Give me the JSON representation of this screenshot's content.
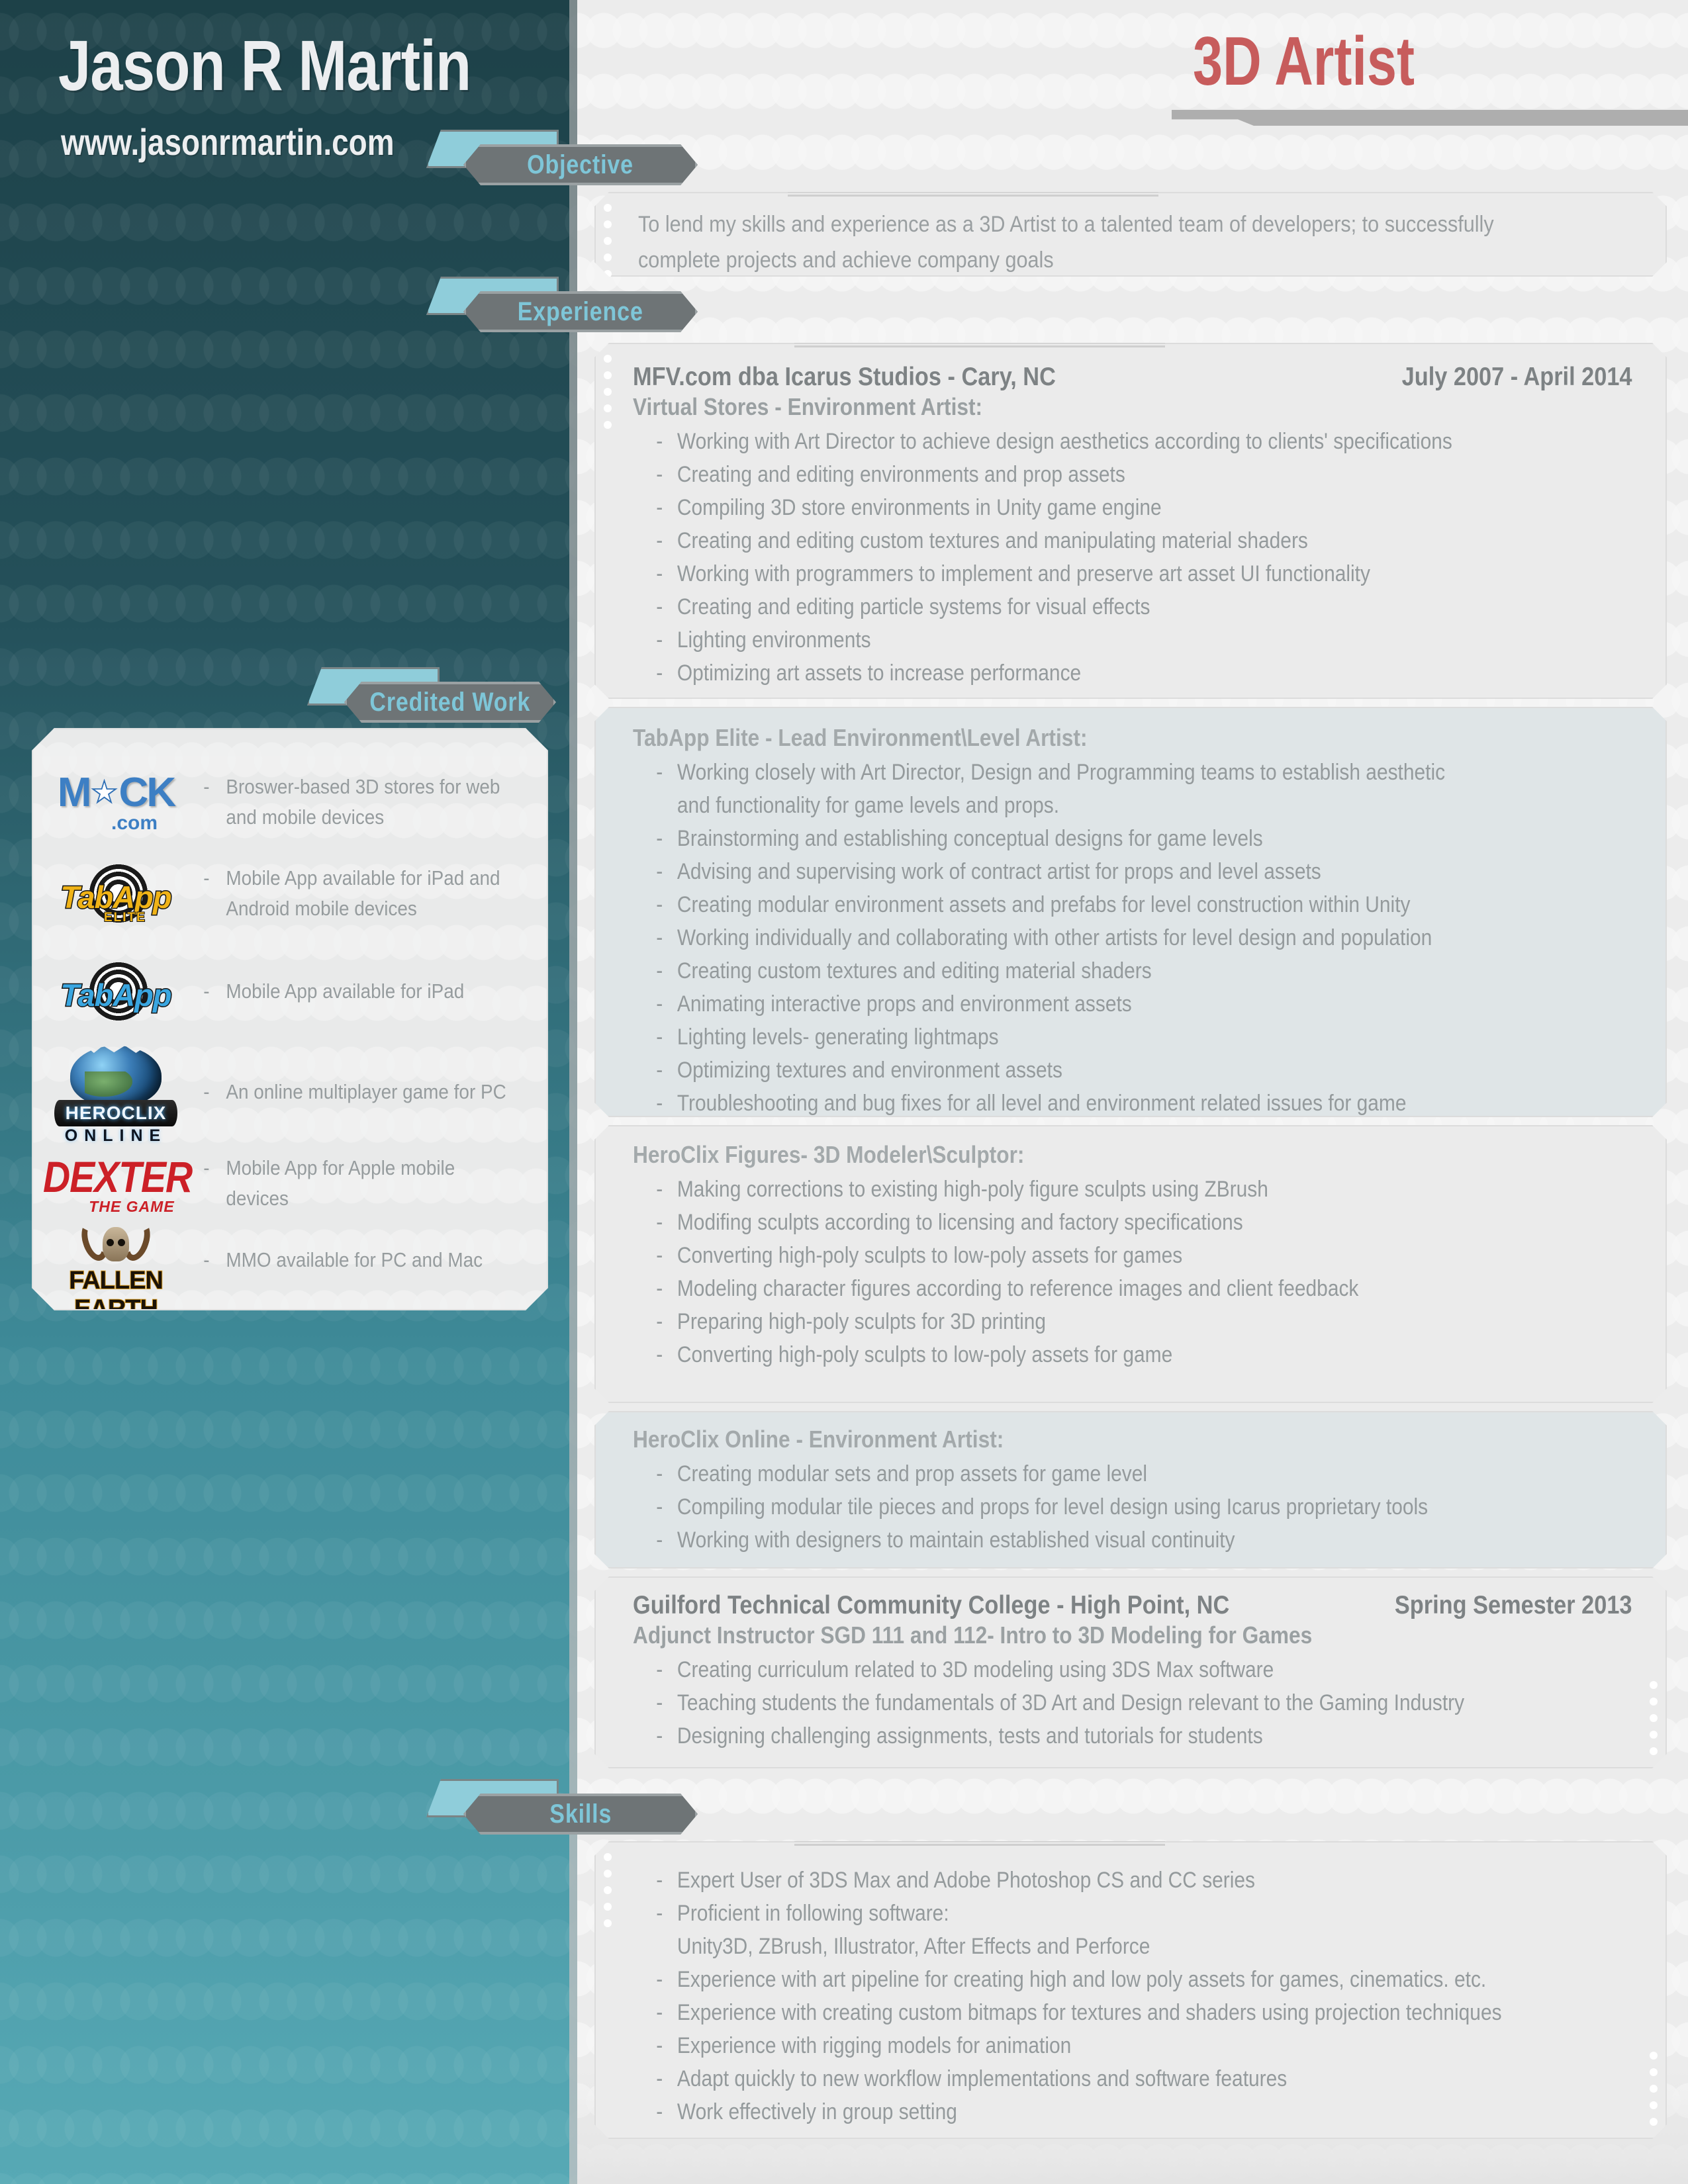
{
  "header": {
    "name": "Jason R Martin",
    "website": "www.jasonrmartin.com",
    "job_title": "3D Artist",
    "accent_red": "#c75c5c",
    "accent_blue": "#7ec6d8",
    "teal_bg": "#2b5f6b"
  },
  "sections": {
    "objective": {
      "tab_label": "Objective",
      "text": "To lend my skills and experience as a 3D Artist to a talented team of developers; to successfully complete projects and achieve company goals"
    },
    "experience": {
      "tab_label": "Experience",
      "jobs": [
        {
          "employer": "MFV.com dba Icarus Studios - Cary, NC",
          "dates": "July 2007 - April 2014",
          "roles": [
            {
              "title": "Virtual Stores - Environment Artist:",
              "shaded": false,
              "bullets": [
                "Working with Art Director to achieve design aesthetics according to clients' specifications",
                "Creating and editing environments and prop assets",
                "Compiling 3D store environments in Unity game engine",
                "Creating and editing custom textures and manipulating material shaders",
                "Working with programmers to implement and preserve art asset UI functionality",
                "Creating and editing particle systems for visual effects",
                "Lighting environments",
                "Optimizing art assets to increase performance"
              ]
            },
            {
              "title": "TabApp Elite - Lead Environment\\Level Artist:",
              "shaded": true,
              "bullets": [
                "Working closely with Art Director, Design and Programming teams to establish aesthetic",
                "and functionality for game levels and props.",
                "Brainstorming and establishing conceptual designs for game levels",
                "Advising and supervising work of contract artist for props and level assets",
                "Creating modular environment assets and prefabs for level construction within Unity",
                "Working individually and collaborating with other artists for level design and population",
                "Creating custom textures and editing material shaders",
                "Animating interactive props and environment assets",
                "Lighting levels- generating lightmaps",
                "Optimizing textures and environment assets",
                "Troubleshooting and bug fixes for all level and environment related issues for game"
              ],
              "continuation_indices": [
                1
              ]
            },
            {
              "title": "HeroClix Figures- 3D Modeler\\Sculptor:",
              "shaded": false,
              "bullets": [
                "Making corrections to existing high-poly figure sculpts using ZBrush",
                "Modifing sculpts according to licensing and factory specifications",
                "Converting high-poly sculpts to low-poly assets for games",
                "Modeling character figures according to reference images and client feedback",
                "Preparing high-poly sculpts for 3D printing",
                "Converting high-poly sculpts to low-poly assets for game"
              ]
            },
            {
              "title": "HeroClix Online - Environment Artist:",
              "shaded": true,
              "bullets": [
                "Creating modular sets and prop assets for game level",
                "Compiling modular tile pieces and props for level design using Icarus proprietary tools",
                "Working with designers to maintain established visual continuity"
              ]
            }
          ]
        },
        {
          "employer": "Guilford Technical Community College - High Point, NC",
          "dates": "Spring Semester 2013",
          "roles": [
            {
              "title": "Adjunct Instructor SGD 111 and 112- Intro to 3D Modeling for Games",
              "shaded": false,
              "bullets": [
                "Creating curriculum related to 3D modeling using 3DS Max software",
                "Teaching students the fundamentals of 3D Art and Design relevant to the Gaming Industry",
                "Designing challenging assignments, tests and tutorials for students"
              ]
            }
          ]
        }
      ]
    },
    "skills": {
      "tab_label": "Skills",
      "bullets": [
        "Expert User of 3DS Max and Adobe Photoshop CS and CC series",
        "Proficient in following software:",
        "Unity3D, ZBrush, Illustrator, After Effects and Perforce",
        "Experience with art pipeline for creating high and low poly assets for games, cinematics. etc.",
        "Experience with creating custom bitmaps for textures and shaders using projection techniques",
        "Experience with rigging models for animation",
        "Adapt quickly to new workflow implementations and software features",
        "Work effectively in group setting"
      ],
      "continuation_indices": [
        2
      ]
    },
    "credited_work": {
      "tab_label": "Credited Work",
      "items": [
        {
          "logo": "mock-logo",
          "logo_text": "MOCK",
          "logo_sub": ".com",
          "description": "Broswer-based 3D stores for web and mobile devices"
        },
        {
          "logo": "tabapp-elite-logo",
          "logo_text": "TabApp",
          "logo_sub": "ELITE",
          "description": "Mobile App available for iPad and Android mobile devices"
        },
        {
          "logo": "tabapp-logo",
          "logo_text": "TabApp",
          "logo_sub": "",
          "description": "Mobile App available for iPad"
        },
        {
          "logo": "heroclix-online-logo",
          "logo_text": "HEROCLIX",
          "logo_sub": "ONLINE",
          "description": "An online multiplayer game for PC"
        },
        {
          "logo": "dexter-logo",
          "logo_text": "DEXTER",
          "logo_sub": "THE GAME",
          "description": "Mobile App for Apple mobile devices"
        },
        {
          "logo": "fallen-earth-logo",
          "logo_text": "FALLEN EARTH",
          "logo_sub": "",
          "description": "MMO available for PC and Mac"
        }
      ]
    }
  }
}
